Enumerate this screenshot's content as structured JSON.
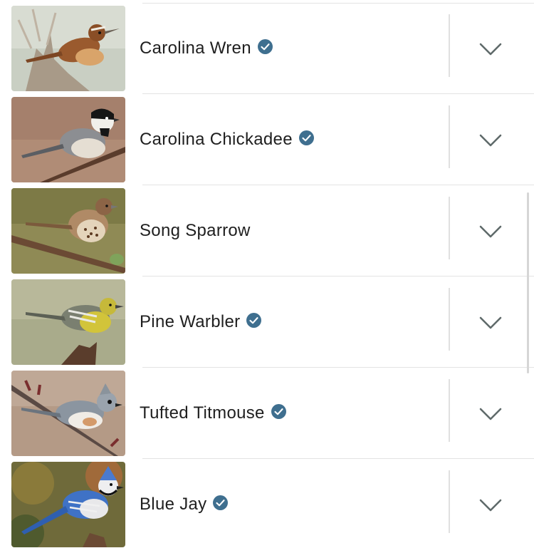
{
  "colors": {
    "verified_badge": "#3f6f8f",
    "chevron": "#5f6a6a",
    "text": "#1f1f1f",
    "divider": "#e0e0e0"
  },
  "icons": {
    "verified": "check-badge-icon",
    "expand": "chevron-down-icon"
  },
  "birds": [
    {
      "name": "Carolina Wren",
      "verified": true
    },
    {
      "name": "Carolina Chickadee",
      "verified": true
    },
    {
      "name": "Song Sparrow",
      "verified": false
    },
    {
      "name": "Pine Warbler",
      "verified": true
    },
    {
      "name": "Tufted Titmouse",
      "verified": true
    },
    {
      "name": "Blue Jay",
      "verified": true
    }
  ]
}
